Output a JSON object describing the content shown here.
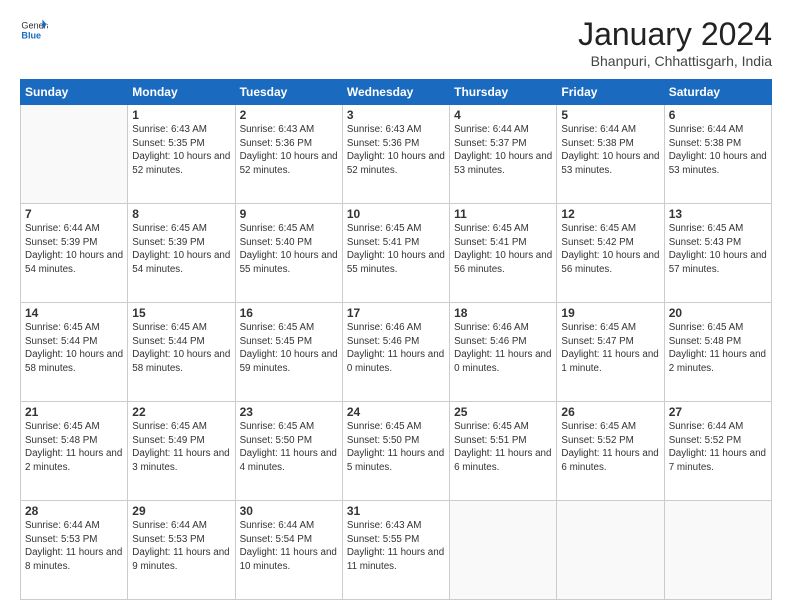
{
  "header": {
    "logo_general": "General",
    "logo_blue": "Blue",
    "month_title": "January 2024",
    "subtitle": "Bhanpuri, Chhattisgarh, India"
  },
  "days_of_week": [
    "Sunday",
    "Monday",
    "Tuesday",
    "Wednesday",
    "Thursday",
    "Friday",
    "Saturday"
  ],
  "weeks": [
    [
      {
        "day": null
      },
      {
        "day": 1,
        "sunrise": "6:43 AM",
        "sunset": "5:35 PM",
        "daylight": "10 hours and 52 minutes."
      },
      {
        "day": 2,
        "sunrise": "6:43 AM",
        "sunset": "5:36 PM",
        "daylight": "10 hours and 52 minutes."
      },
      {
        "day": 3,
        "sunrise": "6:43 AM",
        "sunset": "5:36 PM",
        "daylight": "10 hours and 52 minutes."
      },
      {
        "day": 4,
        "sunrise": "6:44 AM",
        "sunset": "5:37 PM",
        "daylight": "10 hours and 53 minutes."
      },
      {
        "day": 5,
        "sunrise": "6:44 AM",
        "sunset": "5:38 PM",
        "daylight": "10 hours and 53 minutes."
      },
      {
        "day": 6,
        "sunrise": "6:44 AM",
        "sunset": "5:38 PM",
        "daylight": "10 hours and 53 minutes."
      }
    ],
    [
      {
        "day": 7,
        "sunrise": "6:44 AM",
        "sunset": "5:39 PM",
        "daylight": "10 hours and 54 minutes."
      },
      {
        "day": 8,
        "sunrise": "6:45 AM",
        "sunset": "5:39 PM",
        "daylight": "10 hours and 54 minutes."
      },
      {
        "day": 9,
        "sunrise": "6:45 AM",
        "sunset": "5:40 PM",
        "daylight": "10 hours and 55 minutes."
      },
      {
        "day": 10,
        "sunrise": "6:45 AM",
        "sunset": "5:41 PM",
        "daylight": "10 hours and 55 minutes."
      },
      {
        "day": 11,
        "sunrise": "6:45 AM",
        "sunset": "5:41 PM",
        "daylight": "10 hours and 56 minutes."
      },
      {
        "day": 12,
        "sunrise": "6:45 AM",
        "sunset": "5:42 PM",
        "daylight": "10 hours and 56 minutes."
      },
      {
        "day": 13,
        "sunrise": "6:45 AM",
        "sunset": "5:43 PM",
        "daylight": "10 hours and 57 minutes."
      }
    ],
    [
      {
        "day": 14,
        "sunrise": "6:45 AM",
        "sunset": "5:44 PM",
        "daylight": "10 hours and 58 minutes."
      },
      {
        "day": 15,
        "sunrise": "6:45 AM",
        "sunset": "5:44 PM",
        "daylight": "10 hours and 58 minutes."
      },
      {
        "day": 16,
        "sunrise": "6:45 AM",
        "sunset": "5:45 PM",
        "daylight": "10 hours and 59 minutes."
      },
      {
        "day": 17,
        "sunrise": "6:46 AM",
        "sunset": "5:46 PM",
        "daylight": "11 hours and 0 minutes."
      },
      {
        "day": 18,
        "sunrise": "6:46 AM",
        "sunset": "5:46 PM",
        "daylight": "11 hours and 0 minutes."
      },
      {
        "day": 19,
        "sunrise": "6:45 AM",
        "sunset": "5:47 PM",
        "daylight": "11 hours and 1 minute."
      },
      {
        "day": 20,
        "sunrise": "6:45 AM",
        "sunset": "5:48 PM",
        "daylight": "11 hours and 2 minutes."
      }
    ],
    [
      {
        "day": 21,
        "sunrise": "6:45 AM",
        "sunset": "5:48 PM",
        "daylight": "11 hours and 2 minutes."
      },
      {
        "day": 22,
        "sunrise": "6:45 AM",
        "sunset": "5:49 PM",
        "daylight": "11 hours and 3 minutes."
      },
      {
        "day": 23,
        "sunrise": "6:45 AM",
        "sunset": "5:50 PM",
        "daylight": "11 hours and 4 minutes."
      },
      {
        "day": 24,
        "sunrise": "6:45 AM",
        "sunset": "5:50 PM",
        "daylight": "11 hours and 5 minutes."
      },
      {
        "day": 25,
        "sunrise": "6:45 AM",
        "sunset": "5:51 PM",
        "daylight": "11 hours and 6 minutes."
      },
      {
        "day": 26,
        "sunrise": "6:45 AM",
        "sunset": "5:52 PM",
        "daylight": "11 hours and 6 minutes."
      },
      {
        "day": 27,
        "sunrise": "6:44 AM",
        "sunset": "5:52 PM",
        "daylight": "11 hours and 7 minutes."
      }
    ],
    [
      {
        "day": 28,
        "sunrise": "6:44 AM",
        "sunset": "5:53 PM",
        "daylight": "11 hours and 8 minutes."
      },
      {
        "day": 29,
        "sunrise": "6:44 AM",
        "sunset": "5:53 PM",
        "daylight": "11 hours and 9 minutes."
      },
      {
        "day": 30,
        "sunrise": "6:44 AM",
        "sunset": "5:54 PM",
        "daylight": "11 hours and 10 minutes."
      },
      {
        "day": 31,
        "sunrise": "6:43 AM",
        "sunset": "5:55 PM",
        "daylight": "11 hours and 11 minutes."
      },
      {
        "day": null
      },
      {
        "day": null
      },
      {
        "day": null
      }
    ]
  ]
}
